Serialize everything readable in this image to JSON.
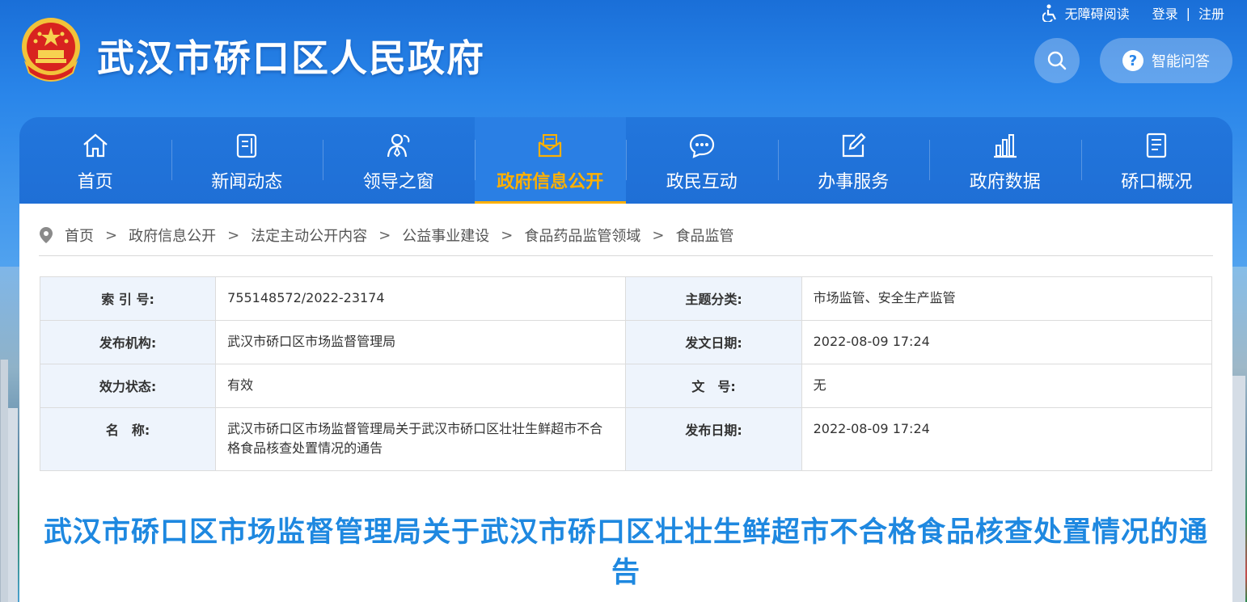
{
  "site": {
    "title": "武汉市硚口区人民政府"
  },
  "toplinks": {
    "accessibility": "无障碍阅读",
    "login": "登录",
    "separator": "|",
    "register": "注册"
  },
  "qa": {
    "label": "智能问答",
    "icon_char": "?"
  },
  "nav": {
    "items": [
      {
        "label": "首页",
        "icon": "home-icon"
      },
      {
        "label": "新闻动态",
        "icon": "news-icon"
      },
      {
        "label": "领导之窗",
        "icon": "leader-icon"
      },
      {
        "label": "政府信息公开",
        "icon": "mail-icon",
        "active": true
      },
      {
        "label": "政民互动",
        "icon": "chat-icon"
      },
      {
        "label": "办事服务",
        "icon": "edit-icon"
      },
      {
        "label": "政府数据",
        "icon": "bar-chart-icon"
      },
      {
        "label": "硚口概况",
        "icon": "document-icon"
      }
    ]
  },
  "breadcrumb": {
    "arrow": ">",
    "items": [
      "首页",
      "政府信息公开",
      "法定主动公开内容",
      "公益事业建设",
      "食品药品监管领域",
      "食品监管"
    ]
  },
  "meta": {
    "index_label": "索 引 号:",
    "index_value": "755148572/2022-23174",
    "topic_label": "主题分类:",
    "topic_value": "市场监管、安全生产监管",
    "publisher_label": "发布机构:",
    "publisher_value": "武汉市硚口区市场监督管理局",
    "issue_date_label": "发文日期:",
    "issue_date_value": "2022-08-09 17:24",
    "status_label": "效力状态:",
    "status_value": "有效",
    "doc_no_label": "文　号:",
    "doc_no_value": "无",
    "name_label": "名　称:",
    "name_value": "武汉市硚口区市场监督管理局关于武汉市硚口区壮壮生鲜超市不合格食品核查处置情况的通告",
    "pub_date_label": "发布日期:",
    "pub_date_value": "2022-08-09 17:24"
  },
  "article": {
    "title": "武汉市硚口区市场监督管理局关于武汉市硚口区壮壮生鲜超市不合格食品核查处置情况的通告"
  },
  "colors": {
    "header_blue": "#1a6fd8",
    "nav_blue": "#1f6fd6",
    "active_gold": "#ffb000",
    "title_blue": "#1e88e0",
    "key_bg": "#eef4fc"
  }
}
